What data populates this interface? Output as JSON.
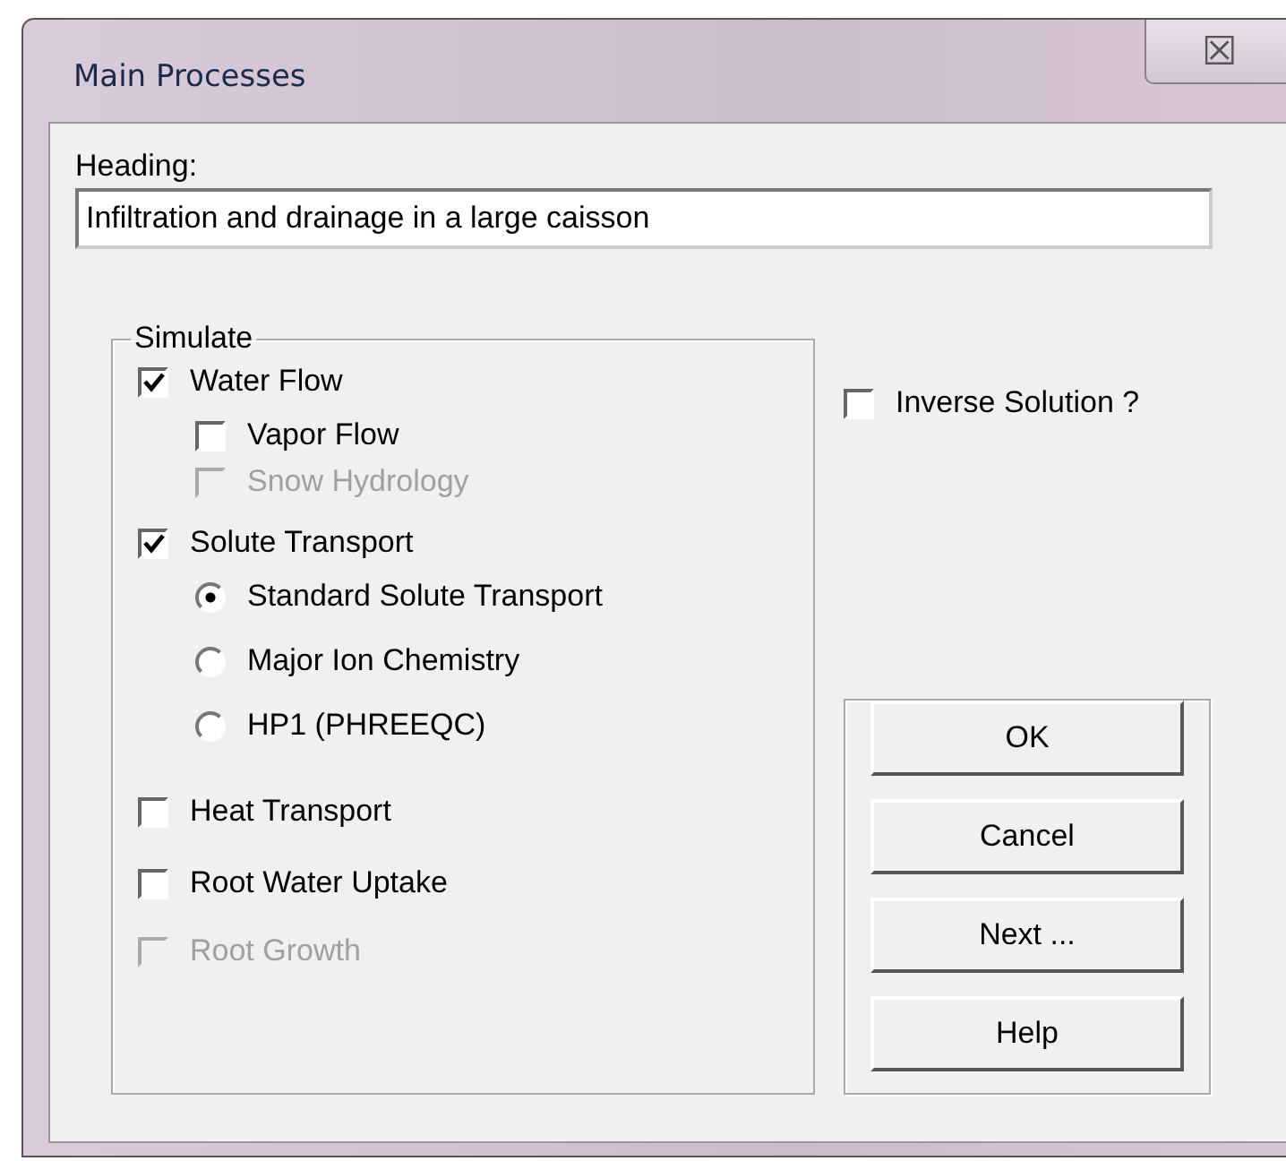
{
  "window": {
    "title": "Main Processes",
    "close": "☒"
  },
  "heading": {
    "label": "Heading:",
    "value": "Infiltration and drainage in a large caisson"
  },
  "simulate": {
    "legend": "Simulate",
    "items": [
      {
        "kind": "checkbox",
        "label": "Water Flow",
        "checked": true,
        "disabled": false,
        "children": [
          {
            "kind": "checkbox",
            "label": "Vapor Flow",
            "checked": false,
            "disabled": false
          },
          {
            "kind": "checkbox",
            "label": "Snow Hydrology",
            "checked": false,
            "disabled": true
          }
        ]
      },
      {
        "kind": "checkbox",
        "label": "Solute Transport",
        "checked": true,
        "disabled": false,
        "children": [
          {
            "kind": "radio",
            "label": "Standard Solute Transport",
            "selected": true
          },
          {
            "kind": "radio",
            "label": "Major Ion Chemistry",
            "selected": false
          },
          {
            "kind": "radio",
            "label": "HP1 (PHREEQC)",
            "selected": false
          }
        ]
      },
      {
        "kind": "checkbox",
        "label": "Heat Transport",
        "checked": false,
        "disabled": false
      },
      {
        "kind": "checkbox",
        "label": "Root Water Uptake",
        "checked": false,
        "disabled": false
      },
      {
        "kind": "checkbox",
        "label": "Root Growth",
        "checked": false,
        "disabled": true
      }
    ]
  },
  "inverse": {
    "label": "Inverse Solution ?",
    "checked": false
  },
  "buttons": [
    "OK",
    "Cancel",
    "Next ...",
    "Help"
  ]
}
